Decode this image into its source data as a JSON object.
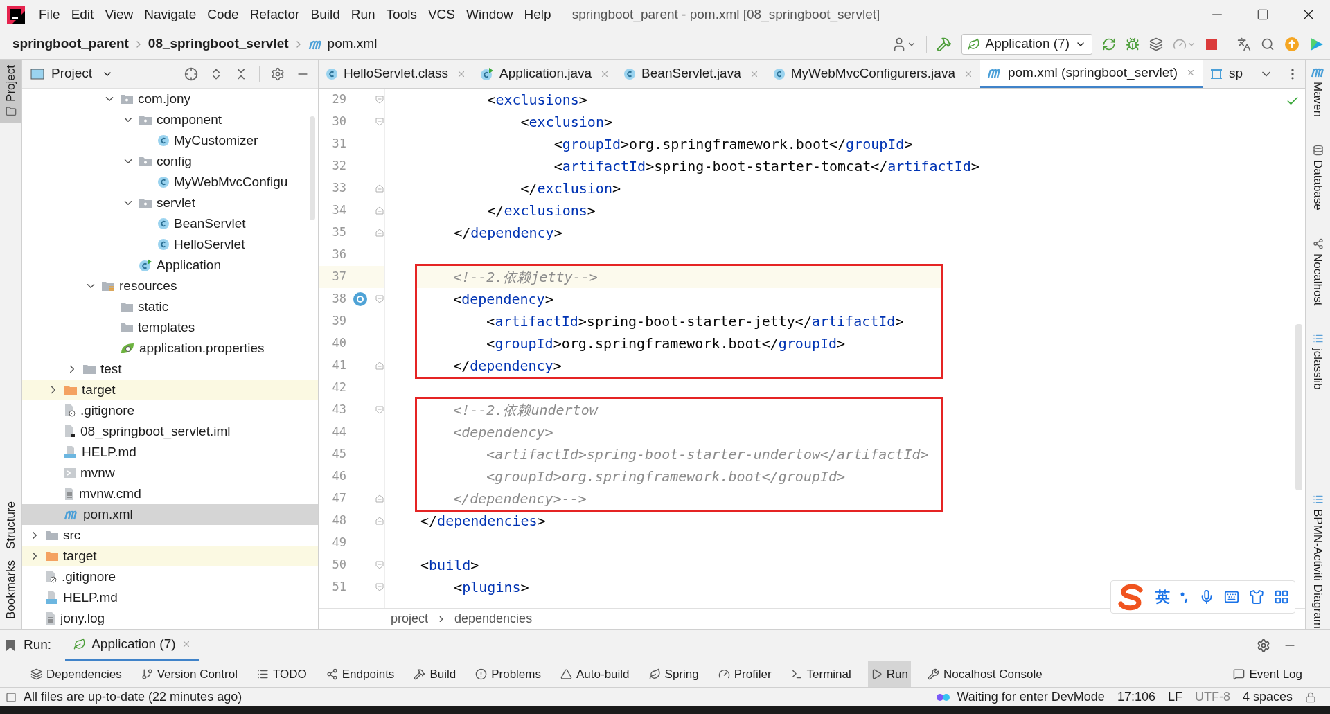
{
  "menu": [
    "File",
    "Edit",
    "View",
    "Navigate",
    "Code",
    "Refactor",
    "Build",
    "Run",
    "Tools",
    "VCS",
    "Window",
    "Help"
  ],
  "window": {
    "title": "springboot_parent - pom.xml [08_springboot_servlet]"
  },
  "breadcrumbs": [
    "springboot_parent",
    "08_springboot_servlet",
    "pom.xml"
  ],
  "run_config": {
    "label": "Application (7)"
  },
  "left_stripe": [
    {
      "label": "Project",
      "selected": true
    },
    {
      "label": "Structure",
      "selected": false
    },
    {
      "label": "Bookmarks",
      "selected": false
    }
  ],
  "right_stripe": [
    "Maven",
    "Database",
    "Nocalhost",
    "jclasslib",
    "BPMN-Activiti Diagram"
  ],
  "project_panel": {
    "title": "Project",
    "tree": [
      {
        "children": [
          {
            "children": [
              {
                "children": [
                  {
                    "children": [
                      {
                        "label": "com.jony",
                        "kind": "package",
                        "expanded": true,
                        "selected": false,
                        "children": [
                          {
                            "label": "component",
                            "kind": "package",
                            "expanded": true,
                            "selected": false,
                            "children": [
                              {
                                "label": "MyCustomizer",
                                "kind": "class",
                                "selected": false
                              }
                            ]
                          },
                          {
                            "label": "config",
                            "kind": "package",
                            "expanded": true,
                            "selected": false,
                            "children": [
                              {
                                "label": "MyWebMvcConfigu",
                                "kind": "class",
                                "selected": false
                              }
                            ]
                          },
                          {
                            "label": "servlet",
                            "kind": "package",
                            "expanded": true,
                            "selected": false,
                            "children": [
                              {
                                "label": "BeanServlet",
                                "kind": "class",
                                "selected": false
                              },
                              {
                                "label": "HelloServlet",
                                "kind": "class",
                                "selected": false
                              }
                            ]
                          },
                          {
                            "label": "Application",
                            "kind": "app",
                            "selected": false
                          }
                        ]
                      }
                    ]
                  },
                  {
                    "label": "resources",
                    "kind": "resources",
                    "expanded": true,
                    "selected": false,
                    "children": [
                      {
                        "label": "static",
                        "kind": "folder",
                        "selected": false
                      },
                      {
                        "label": "templates",
                        "kind": "folder",
                        "selected": false
                      },
                      {
                        "label": "application.properties",
                        "kind": "properties",
                        "selected": false
                      }
                    ]
                  }
                ]
              },
              {
                "label": "test",
                "kind": "folder",
                "expanded": false,
                "selected": false
              }
            ]
          },
          {
            "label": "target",
            "kind": "excluded",
            "expanded": false,
            "selected": false
          },
          {
            "label": ".gitignore",
            "kind": "ignore",
            "selected": false
          },
          {
            "label": "08_springboot_servlet.iml",
            "kind": "iml",
            "selected": false
          },
          {
            "label": "HELP.md",
            "kind": "md",
            "selected": false
          },
          {
            "label": "mvnw",
            "kind": "script",
            "selected": false
          },
          {
            "label": "mvnw.cmd",
            "kind": "text",
            "selected": false
          },
          {
            "label": "pom.xml",
            "kind": "maven",
            "selected": true
          }
        ]
      },
      {
        "label": "src",
        "kind": "folder",
        "expanded": false,
        "selected": false
      },
      {
        "label": "target",
        "kind": "excluded",
        "expanded": false,
        "selected": false
      },
      {
        "label": ".gitignore",
        "kind": "ignore",
        "selected": false
      },
      {
        "label": "HELP.md",
        "kind": "md",
        "selected": false
      },
      {
        "label": "jony.log",
        "kind": "text",
        "selected": false
      }
    ]
  },
  "editor_tabs": [
    {
      "label": "HelloServlet.class",
      "kind": "class",
      "selected": false
    },
    {
      "label": "Application.java",
      "kind": "app",
      "selected": false
    },
    {
      "label": "BeanServlet.java",
      "kind": "class",
      "selected": false
    },
    {
      "label": "MyWebMvcConfigurers.java",
      "kind": "class",
      "selected": false
    },
    {
      "label": "pom.xml (springboot_servlet)",
      "kind": "maven",
      "selected": true
    },
    {
      "label": "sp",
      "kind": "diagram",
      "selected": false
    }
  ],
  "editor": {
    "blocks": [
      {
        "boxed": false,
        "lines": [
          {
            "number": "29",
            "fold_open": true,
            "segments": [
              {
                "kind": "plain",
                "text": "        <"
              },
              {
                "kind": "tag",
                "text": "exclusions"
              },
              {
                "kind": "plain",
                "text": ">"
              }
            ]
          },
          {
            "number": "30",
            "fold_open": true,
            "segments": [
              {
                "kind": "plain",
                "text": "            <"
              },
              {
                "kind": "tag",
                "text": "exclusion"
              },
              {
                "kind": "plain",
                "text": ">"
              }
            ]
          },
          {
            "number": "31",
            "segments": [
              {
                "kind": "plain",
                "text": "                <"
              },
              {
                "kind": "tag",
                "text": "groupId"
              },
              {
                "kind": "plain",
                "text": ">org.springframework.boot</"
              },
              {
                "kind": "tag",
                "text": "groupId"
              },
              {
                "kind": "plain",
                "text": ">"
              }
            ]
          },
          {
            "number": "32",
            "segments": [
              {
                "kind": "plain",
                "text": "                <"
              },
              {
                "kind": "tag",
                "text": "artifactId"
              },
              {
                "kind": "plain",
                "text": ">spring-boot-starter-tomcat</"
              },
              {
                "kind": "tag",
                "text": "artifactId"
              },
              {
                "kind": "plain",
                "text": ">"
              }
            ]
          },
          {
            "number": "33",
            "fold_close": true,
            "segments": [
              {
                "kind": "plain",
                "text": "            </"
              },
              {
                "kind": "tag",
                "text": "exclusion"
              },
              {
                "kind": "plain",
                "text": ">"
              }
            ]
          },
          {
            "number": "34",
            "fold_close": true,
            "segments": [
              {
                "kind": "plain",
                "text": "        </"
              },
              {
                "kind": "tag",
                "text": "exclusions"
              },
              {
                "kind": "plain",
                "text": ">"
              }
            ]
          },
          {
            "number": "35",
            "fold_close": true,
            "segments": [
              {
                "kind": "plain",
                "text": "    </"
              },
              {
                "kind": "tag",
                "text": "dependency"
              },
              {
                "kind": "plain",
                "text": ">"
              }
            ]
          },
          {
            "number": "36"
          }
        ]
      },
      {
        "boxed": true,
        "lines": [
          {
            "number": "37",
            "current": true,
            "segments": [
              {
                "kind": "comment",
                "text": "    <!--2.依赖jetty-->"
              }
            ]
          },
          {
            "number": "38",
            "fold_open": true,
            "gutter_icon": true,
            "segments": [
              {
                "kind": "plain",
                "text": "    <"
              },
              {
                "kind": "tag",
                "text": "dependency"
              },
              {
                "kind": "plain",
                "text": ">"
              }
            ]
          },
          {
            "number": "39",
            "segments": [
              {
                "kind": "plain",
                "text": "        <"
              },
              {
                "kind": "tag",
                "text": "artifactId"
              },
              {
                "kind": "plain",
                "text": ">spring-boot-starter-jetty</"
              },
              {
                "kind": "tag",
                "text": "artifactId"
              },
              {
                "kind": "plain",
                "text": ">"
              }
            ]
          },
          {
            "number": "40",
            "segments": [
              {
                "kind": "plain",
                "text": "        <"
              },
              {
                "kind": "tag",
                "text": "groupId"
              },
              {
                "kind": "plain",
                "text": ">org.springframework.boot</"
              },
              {
                "kind": "tag",
                "text": "groupId"
              },
              {
                "kind": "plain",
                "text": ">"
              }
            ]
          },
          {
            "number": "41",
            "fold_close": true,
            "segments": [
              {
                "kind": "plain",
                "text": "    </"
              },
              {
                "kind": "tag",
                "text": "dependency"
              },
              {
                "kind": "plain",
                "text": ">"
              }
            ]
          }
        ]
      },
      {
        "boxed": false,
        "lines": [
          {
            "number": "42"
          }
        ]
      },
      {
        "boxed": true,
        "lines": [
          {
            "number": "43",
            "fold_open": true,
            "segments": [
              {
                "kind": "comment",
                "text": "    <!--2.依赖undertow"
              }
            ]
          },
          {
            "number": "44",
            "segments": [
              {
                "kind": "comment",
                "text": "    <dependency>"
              }
            ]
          },
          {
            "number": "45",
            "segments": [
              {
                "kind": "comment",
                "text": "        <artifactId>spring-boot-starter-undertow</artifactId>"
              }
            ]
          },
          {
            "number": "46",
            "segments": [
              {
                "kind": "comment",
                "text": "        <groupId>org.springframework.boot</groupId>"
              }
            ]
          },
          {
            "number": "47",
            "fold_close": true,
            "segments": [
              {
                "kind": "comment",
                "text": "    </dependency>-->"
              }
            ]
          }
        ]
      },
      {
        "boxed": false,
        "lines": [
          {
            "number": "48",
            "fold_close": true,
            "segments": [
              {
                "kind": "plain",
                "text": "</"
              },
              {
                "kind": "tag",
                "text": "dependencies"
              },
              {
                "kind": "plain",
                "text": ">"
              }
            ]
          },
          {
            "number": "49"
          },
          {
            "number": "50",
            "fold_open": true,
            "segments": [
              {
                "kind": "plain",
                "text": "<"
              },
              {
                "kind": "tag",
                "text": "build"
              },
              {
                "kind": "plain",
                "text": ">"
              }
            ]
          },
          {
            "number": "51",
            "fold_open": true,
            "segments": [
              {
                "kind": "plain",
                "text": "    <"
              },
              {
                "kind": "tag",
                "text": "plugins"
              },
              {
                "kind": "plain",
                "text": ">"
              }
            ]
          }
        ]
      }
    ],
    "path": [
      "project",
      "dependencies"
    ]
  },
  "run_panel": {
    "label": "Run:",
    "tab": "Application (7)"
  },
  "tool_windows": [
    {
      "label": "Dependencies",
      "selected": false
    },
    {
      "label": "Version Control",
      "selected": false
    },
    {
      "label": "TODO",
      "selected": false
    },
    {
      "label": "Endpoints",
      "selected": false
    },
    {
      "label": "Build",
      "selected": false
    },
    {
      "label": "Problems",
      "selected": false
    },
    {
      "label": "Auto-build",
      "selected": false
    },
    {
      "label": "Spring",
      "selected": false
    },
    {
      "label": "Profiler",
      "selected": false
    },
    {
      "label": "Terminal",
      "selected": false
    },
    {
      "label": "Run",
      "selected": true
    },
    {
      "label": "Nocalhost Console",
      "selected": false
    }
  ],
  "event_log": "Event Log",
  "ime_toolbar": {
    "label": "英"
  },
  "status_bar": {
    "message": "All files are up-to-date (22 minutes ago)",
    "devmode": "Waiting for enter DevMode",
    "position": "17:106",
    "line_ending": "LF",
    "encoding": "UTF-8",
    "indent": "4 spaces"
  }
}
